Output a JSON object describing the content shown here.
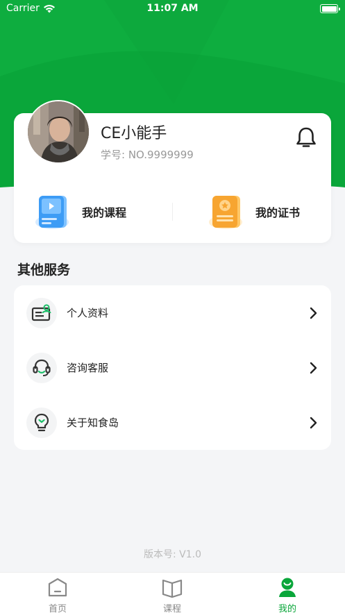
{
  "status_bar": {
    "carrier": "Carrier",
    "time": "11:07 AM"
  },
  "profile": {
    "name": "CE小能手",
    "student_no": "学号: NO.9999999"
  },
  "quick_links": [
    {
      "label": "我的课程",
      "icon": "course-book-icon"
    },
    {
      "label": "我的证书",
      "icon": "certificate-icon"
    }
  ],
  "services": {
    "title": "其他服务",
    "items": [
      {
        "label": "个人资料",
        "icon": "profile-card-icon"
      },
      {
        "label": "咨询客服",
        "icon": "headset-icon"
      },
      {
        "label": "关于知食岛",
        "icon": "bulb-icon"
      }
    ]
  },
  "version": "版本号: V1.0",
  "tabs": [
    {
      "label": "首页",
      "icon": "home-icon",
      "active": false
    },
    {
      "label": "课程",
      "icon": "book-icon",
      "active": false
    },
    {
      "label": "我的",
      "icon": "user-icon",
      "active": true
    }
  ],
  "colors": {
    "brand_green": "#0aa63a",
    "course_blue": "#4aa3f5",
    "certificate_orange": "#f7a531"
  }
}
